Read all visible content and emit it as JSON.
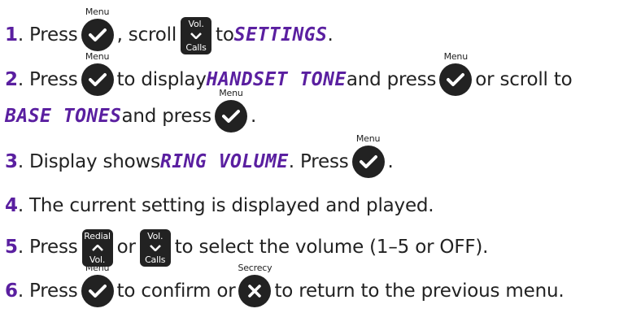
{
  "keys": {
    "menu": "Menu",
    "vol": "Vol.",
    "calls": "Calls",
    "redial": "Redial",
    "secrecy": "Secrecy"
  },
  "steps": [
    {
      "num": "1",
      "t1": ". Press ",
      "t2": ", scroll ",
      "t3": " to ",
      "lcd1": "SETTINGS",
      "t4": "."
    },
    {
      "num": "2",
      "t1": ". Press ",
      "t2": " to display ",
      "lcd1": "HANDSET TONE",
      "t3": " and press ",
      "t4": " or scroll to"
    },
    {
      "lcd1": "BASE TONES",
      "t1": " and press ",
      "t2": "."
    },
    {
      "num": "3",
      "t1": ". Display shows ",
      "lcd1": "RING VOLUME",
      "t2": ". Press ",
      "t3": "."
    },
    {
      "num": "4",
      "t1": ". The current setting is displayed and played."
    },
    {
      "num": "5",
      "t1": ". Press ",
      "t2": " or ",
      "t3": " to select the volume (1–5 or OFF)."
    },
    {
      "num": "6",
      "t1": ". Press ",
      "t2": " to confirm or ",
      "t3": " to return to the previous menu."
    }
  ],
  "colors": {
    "accent": "#5a1fa0",
    "key": "#222222"
  }
}
